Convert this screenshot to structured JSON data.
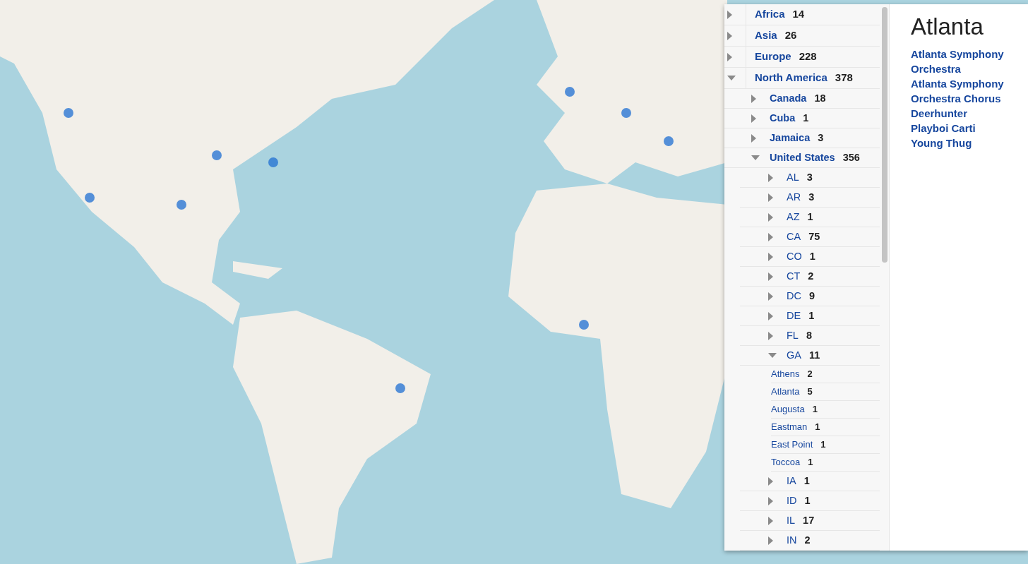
{
  "tree": [
    {
      "label": "Africa",
      "count": "14",
      "expanded": false
    },
    {
      "label": "Asia",
      "count": "26",
      "expanded": false
    },
    {
      "label": "Europe",
      "count": "228",
      "expanded": false
    },
    {
      "label": "North America",
      "count": "378",
      "expanded": true,
      "children": [
        {
          "label": "Canada",
          "count": "18",
          "expanded": false
        },
        {
          "label": "Cuba",
          "count": "1",
          "expanded": false
        },
        {
          "label": "Jamaica",
          "count": "3",
          "expanded": false
        },
        {
          "label": "United States",
          "count": "356",
          "expanded": true,
          "children": [
            {
              "label": "AL",
              "count": "3",
              "expanded": false
            },
            {
              "label": "AR",
              "count": "3",
              "expanded": false
            },
            {
              "label": "AZ",
              "count": "1",
              "expanded": false
            },
            {
              "label": "CA",
              "count": "75",
              "expanded": false
            },
            {
              "label": "CO",
              "count": "1",
              "expanded": false
            },
            {
              "label": "CT",
              "count": "2",
              "expanded": false
            },
            {
              "label": "DC",
              "count": "9",
              "expanded": false
            },
            {
              "label": "DE",
              "count": "1",
              "expanded": false
            },
            {
              "label": "FL",
              "count": "8",
              "expanded": false
            },
            {
              "label": "GA",
              "count": "11",
              "expanded": true,
              "children": [
                {
                  "label": "Athens",
                  "count": "2"
                },
                {
                  "label": "Atlanta",
                  "count": "5"
                },
                {
                  "label": "Augusta",
                  "count": "1"
                },
                {
                  "label": "Eastman",
                  "count": "1"
                },
                {
                  "label": "East Point",
                  "count": "1"
                },
                {
                  "label": "Toccoa",
                  "count": "1"
                }
              ]
            },
            {
              "label": "IA",
              "count": "1",
              "expanded": false
            },
            {
              "label": "ID",
              "count": "1",
              "expanded": false
            },
            {
              "label": "IL",
              "count": "17",
              "expanded": false
            },
            {
              "label": "IN",
              "count": "2",
              "expanded": false
            }
          ]
        }
      ]
    }
  ],
  "detail": {
    "title": "Atlanta",
    "links": [
      "Atlanta Symphony Orchestra",
      "Atlanta Symphony Orchestra Chorus",
      "Deerhunter",
      "Playboi Carti",
      "Young Thug"
    ]
  }
}
